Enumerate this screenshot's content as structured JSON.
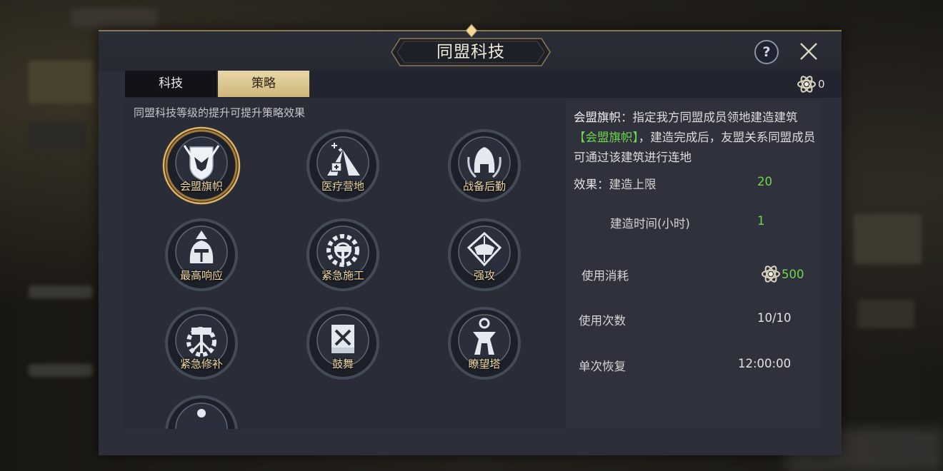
{
  "window": {
    "title": "同盟科技"
  },
  "tabs": [
    {
      "label": "科技",
      "active": false
    },
    {
      "label": "策略",
      "active": true
    }
  ],
  "currency": {
    "value": "0",
    "icon": "atom-icon"
  },
  "hint": "同盟科技等级的提升可提升策略效果",
  "strategies": [
    {
      "label": "会盟旗帜",
      "icon": "eagle-shield-icon",
      "selected": true
    },
    {
      "label": "医疗营地",
      "icon": "medical-tent-icon",
      "selected": false
    },
    {
      "label": "战备后勤",
      "icon": "helmet-laurel-icon",
      "selected": false
    },
    {
      "label": "最高响应",
      "icon": "knight-helmet-icon",
      "selected": false
    },
    {
      "label": "紧急施工",
      "icon": "gear-hammer-icon",
      "selected": false
    },
    {
      "label": "强攻",
      "icon": "crossed-swords-icon",
      "selected": false
    },
    {
      "label": "紧急修补",
      "icon": "gear-wrench-icon",
      "selected": false
    },
    {
      "label": "鼓舞",
      "icon": "banner-icon",
      "selected": false
    },
    {
      "label": "瞭望塔",
      "icon": "watchtower-icon",
      "selected": false
    },
    {
      "label": "",
      "icon": "locked-strategy-icon",
      "selected": false
    }
  ],
  "detail": {
    "name": "会盟旗帜",
    "desc_1": "：指定我方同盟成员领地建造建筑",
    "desc_highlight": "【会盟旗帜】",
    "desc_2": "，建造完成后，友盟关系同盟成员可通过该建筑进行连地",
    "effect_label": "效果：",
    "build_limit_label": "建造上限",
    "build_limit_value": "20",
    "build_time_label": "建造时间(小时)",
    "build_time_value": "1",
    "cost_label": "使用消耗",
    "cost_value": "500",
    "uses_label": "使用次数",
    "uses_value": "10/10",
    "recover_label": "单次恢复",
    "recover_value": "12:00:00"
  },
  "colors": {
    "accent_gold": "#cdb67a",
    "highlight_green": "#6ed64a",
    "panel": "#2c2f3a"
  }
}
